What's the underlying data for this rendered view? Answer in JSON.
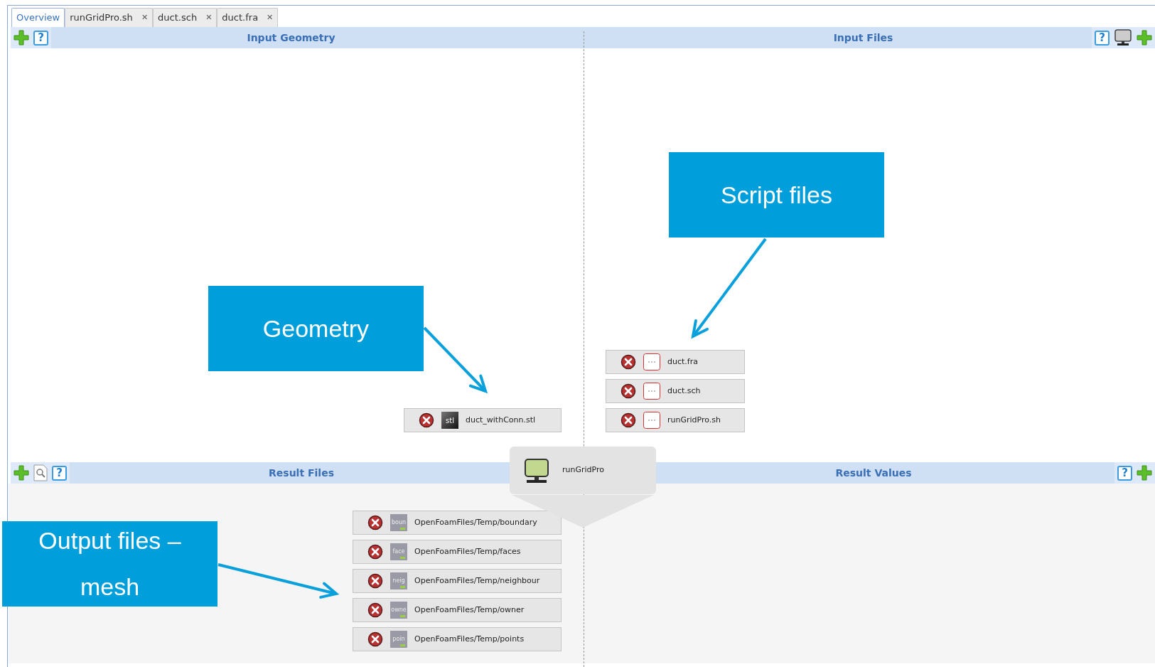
{
  "tabs": [
    {
      "label": "Overview",
      "selected": true
    },
    {
      "label": "runGridPro.sh",
      "selected": false,
      "close": "✕"
    },
    {
      "label": "duct.sch",
      "selected": false,
      "close": "✕"
    },
    {
      "label": "duct.fra",
      "selected": false,
      "close": "✕"
    }
  ],
  "sections": [
    {
      "title": "Input Geometry",
      "buttons": [
        {
          "kind": "add"
        },
        {
          "kind": "help",
          "label": "?"
        }
      ]
    },
    {
      "title": "Input Files",
      "buttons": [
        {
          "kind": "help",
          "label": "?"
        },
        {
          "kind": "monitor"
        },
        {
          "kind": "add"
        }
      ]
    },
    {
      "title": "Result Files",
      "buttons": [
        {
          "kind": "add"
        },
        {
          "kind": "search"
        },
        {
          "kind": "help",
          "label": "?"
        }
      ]
    },
    {
      "title": "Result Values",
      "buttons": [
        {
          "kind": "help",
          "label": "?"
        },
        {
          "kind": "add"
        }
      ]
    }
  ],
  "geometry_files": [
    {
      "name": "duct_withConn.stl",
      "kind": "stl",
      "icon_label": "stl"
    }
  ],
  "script_files": [
    {
      "name": "duct.fra",
      "kind": "script"
    },
    {
      "name": "duct.sch",
      "kind": "script"
    },
    {
      "name": "runGridPro.sh",
      "kind": "script"
    }
  ],
  "tool": {
    "name": "runGridPro"
  },
  "result_files": [
    {
      "name": "OpenFoamFiles/Temp/boundary",
      "kind": "mesh",
      "icon_label": "boun"
    },
    {
      "name": "OpenFoamFiles/Temp/faces",
      "kind": "mesh",
      "icon_label": "face"
    },
    {
      "name": "OpenFoamFiles/Temp/neighbour",
      "kind": "mesh",
      "icon_label": "neig"
    },
    {
      "name": "OpenFoamFiles/Temp/owner",
      "kind": "mesh",
      "icon_label": "owne"
    },
    {
      "name": "OpenFoamFiles/Temp/points",
      "kind": "mesh",
      "icon_label": "poin"
    }
  ],
  "callouts": [
    {
      "text": "Geometry"
    },
    {
      "text": "Script files"
    },
    {
      "text": "Output files – mesh"
    }
  ]
}
